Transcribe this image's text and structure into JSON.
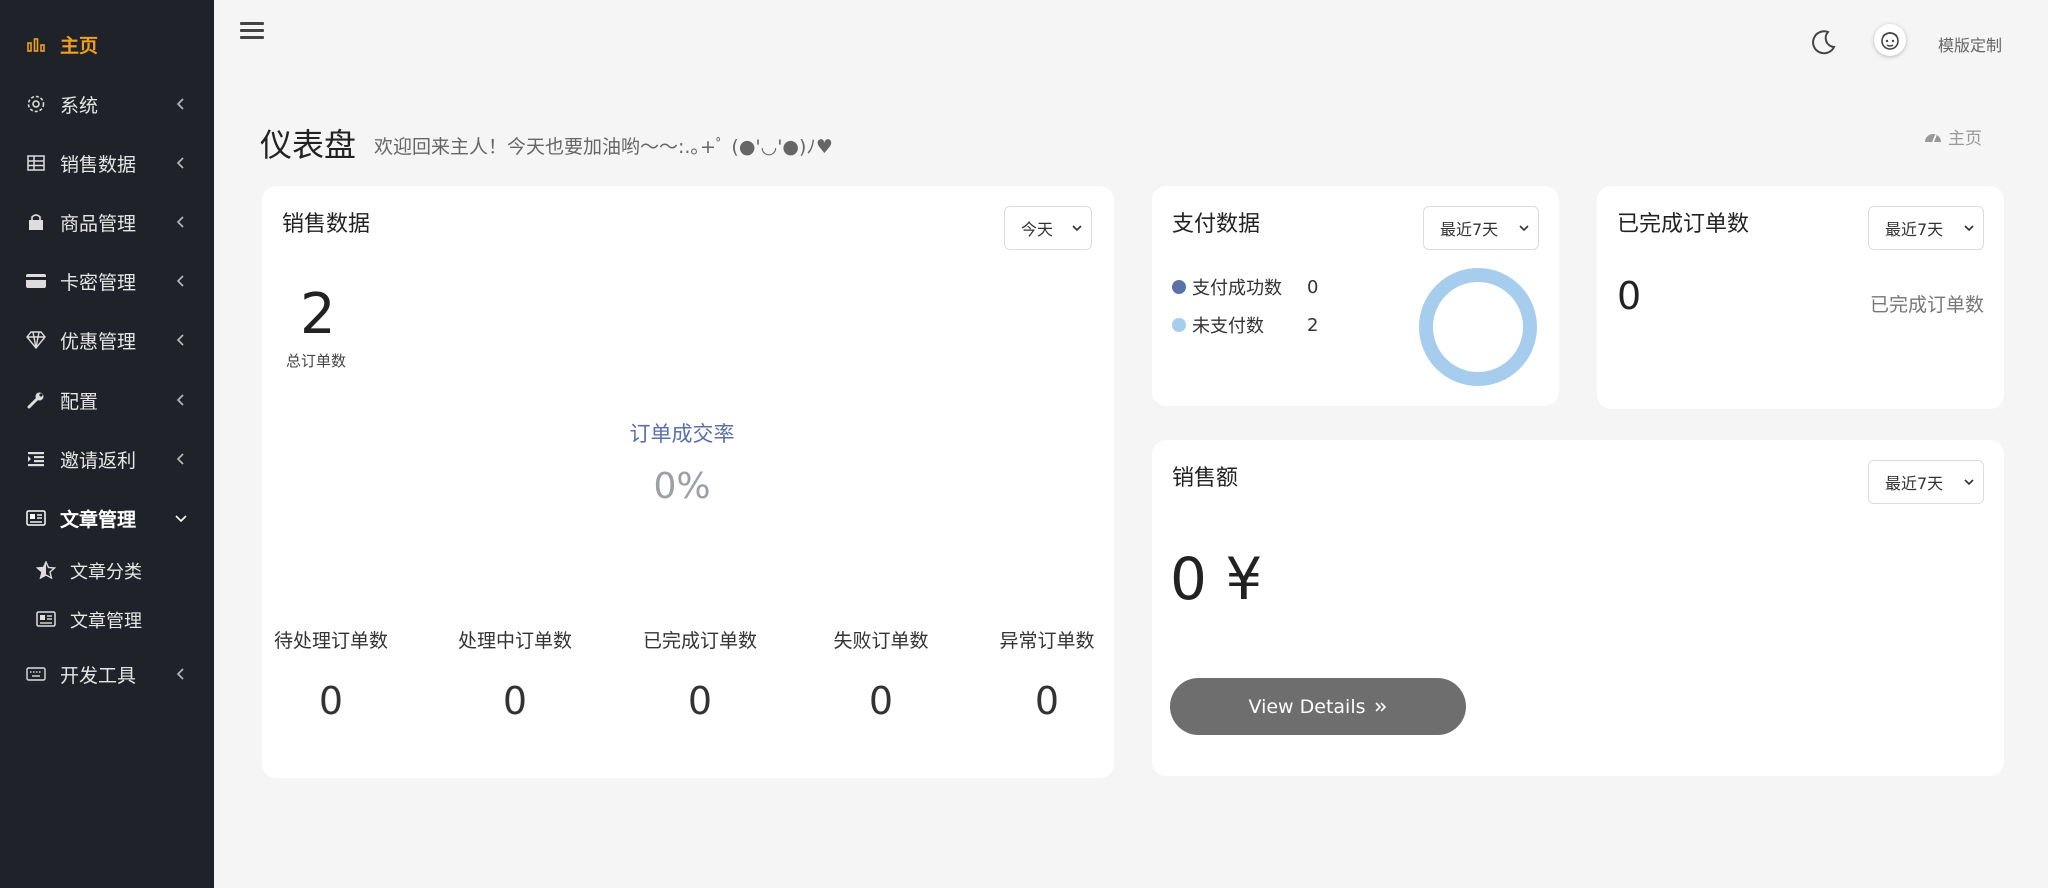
{
  "sidebar": {
    "items": [
      {
        "label": "主页",
        "icon": "bar-chart-icon"
      },
      {
        "label": "系统",
        "icon": "gear-icon"
      },
      {
        "label": "销售数据",
        "icon": "table-icon"
      },
      {
        "label": "商品管理",
        "icon": "shopping-bag-icon"
      },
      {
        "label": "卡密管理",
        "icon": "credit-card-icon"
      },
      {
        "label": "优惠管理",
        "icon": "diamond-icon"
      },
      {
        "label": "配置",
        "icon": "wrench-icon"
      },
      {
        "label": "邀请返利",
        "icon": "list-indent-icon"
      },
      {
        "label": "文章管理",
        "icon": "newspaper-icon"
      },
      {
        "label": "开发工具",
        "icon": "keyboard-icon"
      }
    ],
    "sub_items": [
      {
        "label": "文章分类",
        "icon": "star-icon"
      },
      {
        "label": "文章管理",
        "icon": "newspaper-icon"
      }
    ],
    "active_color": "#f0a020"
  },
  "header": {
    "custom_label": "模版定制"
  },
  "page": {
    "title": "仪表盘",
    "subtitle": "欢迎回来主人！今天也要加油哟～～:.｡+ﾟ (●'◡'●)ﾉ♥",
    "breadcrumb": "主页"
  },
  "sales_card": {
    "title": "销售数据",
    "range": "今天",
    "total_orders": "2",
    "total_orders_label": "总订单数",
    "rate_title": "订单成交率",
    "rate_value": "0%",
    "stats": [
      {
        "label": "待处理订单数",
        "value": "0"
      },
      {
        "label": "处理中订单数",
        "value": "0"
      },
      {
        "label": "已完成订单数",
        "value": "0"
      },
      {
        "label": "失败订单数",
        "value": "0"
      },
      {
        "label": "异常订单数",
        "value": "0"
      }
    ]
  },
  "payment_card": {
    "title": "支付数据",
    "range": "最近7天",
    "legend": [
      {
        "label": "支付成功数",
        "value": "0",
        "color": "#5b6fa8"
      },
      {
        "label": "未支付数",
        "value": "2",
        "color": "#a6cdee"
      }
    ]
  },
  "completed_card": {
    "title": "已完成订单数",
    "range": "最近7天",
    "value": "0",
    "label": "已完成订单数"
  },
  "revenue_card": {
    "title": "销售额",
    "range": "最近7天",
    "amount": "0 ¥",
    "button_label": "View Details",
    "button_color": "#6e6e6e"
  },
  "chart_data": {
    "type": "pie",
    "categories": [
      "支付成功数",
      "未支付数"
    ],
    "values": [
      0,
      2
    ],
    "colors": [
      "#5b6fa8",
      "#a6cdee"
    ]
  }
}
